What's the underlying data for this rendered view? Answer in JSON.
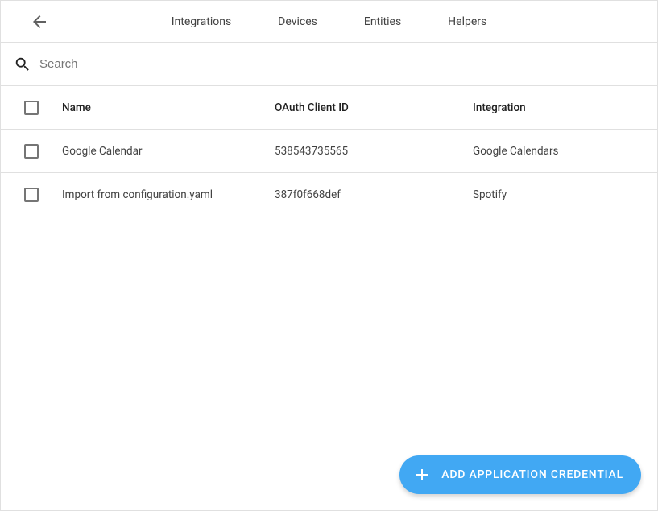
{
  "tabs": {
    "integrations": "Integrations",
    "devices": "Devices",
    "entities": "Entities",
    "helpers": "Helpers"
  },
  "search": {
    "placeholder": "Search",
    "value": ""
  },
  "columns": {
    "name": "Name",
    "oauth_client_id": "OAuth Client ID",
    "integration": "Integration"
  },
  "rows": [
    {
      "name": "Google Calendar",
      "oauth_client_id": "538543735565",
      "integration": "Google Calendars"
    },
    {
      "name": "Import from configuration.yaml",
      "oauth_client_id": "387f0f668def",
      "integration": "Spotify"
    }
  ],
  "fab": {
    "label": "ADD APPLICATION CREDENTIAL"
  }
}
